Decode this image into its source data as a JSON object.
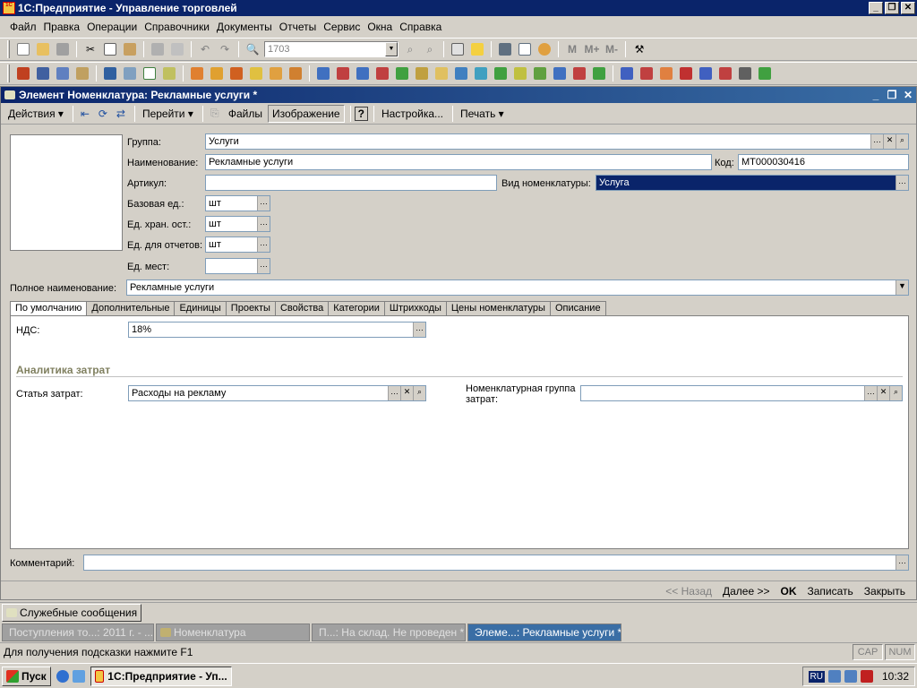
{
  "app": {
    "title": "1С:Предприятие - Управление торговлей"
  },
  "menu": [
    "Файл",
    "Правка",
    "Операции",
    "Справочники",
    "Документы",
    "Отчеты",
    "Сервис",
    "Окна",
    "Справка"
  ],
  "toolbar": {
    "combo_value": "1703",
    "m_labels": [
      "M",
      "M+",
      "M-"
    ]
  },
  "document": {
    "title": "Элемент Номенклатура: Рекламные услуги *",
    "toolbar": {
      "actions": "Действия",
      "goto": "Перейти",
      "files": "Файлы",
      "image": "Изображение",
      "help": "?",
      "settings": "Настройка...",
      "print": "Печать"
    },
    "fields": {
      "group_label": "Группа:",
      "group_value": "Услуги",
      "name_label": "Наименование:",
      "name_value": "Рекламные услуги",
      "code_label": "Код:",
      "code_value": "МТ000030416",
      "article_label": "Артикул:",
      "article_value": "",
      "kind_label": "Вид номенклатуры:",
      "kind_value": "Услуга",
      "base_unit_label": "Базовая ед.:",
      "base_unit_value": "шт",
      "storage_unit_label": "Ед. хран. ост.:",
      "storage_unit_value": "шт",
      "report_unit_label": "Ед. для отчетов:",
      "report_unit_value": "шт",
      "place_unit_label": "Ед. мест:",
      "place_unit_value": "",
      "full_name_label": "Полное наименование:",
      "full_name_value": "Рекламные услуги"
    },
    "tabs": [
      "По умолчанию",
      "Дополнительные",
      "Единицы",
      "Проекты",
      "Свойства",
      "Категории",
      "Штрихкоды",
      "Цены номенклатуры",
      "Описание"
    ],
    "tab_panel": {
      "vat_label": "НДС:",
      "vat_value": "18%",
      "section_title": "Аналитика затрат",
      "cost_item_label": "Статья затрат:",
      "cost_item_value": "Расходы на рекламу",
      "nom_group_label": "Номенклатурная группа затрат:",
      "nom_group_value": ""
    },
    "comment_label": "Комментарий:",
    "comment_value": "",
    "buttons": {
      "back": "<< Назад",
      "next": "Далее >>",
      "ok": "OK",
      "save": "Записать",
      "close": "Закрыть"
    }
  },
  "messages_button": "Служебные сообщения",
  "window_list": [
    "Поступления то...: 2011 г. - ...",
    "Номенклатура",
    "П...: На склад. Не проведен *",
    "Элеме...: Рекламные услуги *"
  ],
  "status": {
    "hint": "Для получения подсказки нажмите F1",
    "cap": "CAP",
    "num": "NUM"
  },
  "taskbar": {
    "start": "Пуск",
    "task": "1С:Предприятие - Уп...",
    "lang": "RU",
    "time": "10:32"
  }
}
